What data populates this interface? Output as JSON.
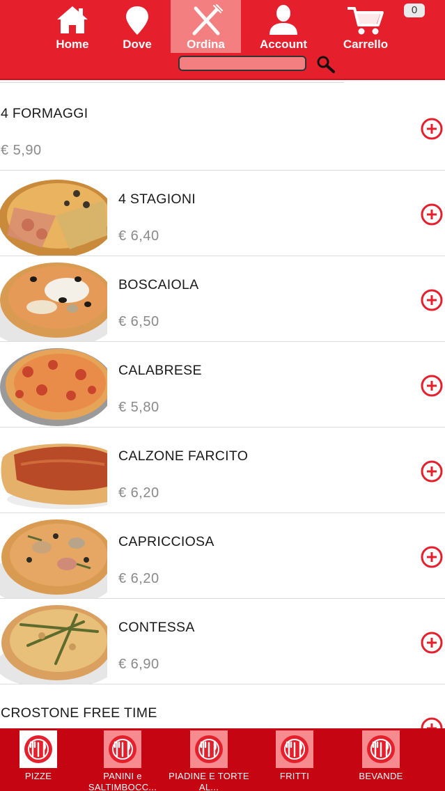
{
  "colors": {
    "brand_red": "#e5202c",
    "active_tab": "#f37f80",
    "tabbar_red": "#c50612",
    "add_icon": "#e5202c"
  },
  "header": {
    "nav": [
      {
        "label": "Home",
        "icon": "home-icon"
      },
      {
        "label": "Dove",
        "icon": "map-pin-icon"
      },
      {
        "label": "Ordina",
        "icon": "cutlery-icon",
        "active": true
      },
      {
        "label": "Account",
        "icon": "user-icon"
      },
      {
        "label": "Carrello",
        "icon": "cart-icon"
      }
    ],
    "cart_count": "0",
    "search": {
      "value": "",
      "placeholder": ""
    }
  },
  "menu": [
    {
      "name": "4 FORMAGGI",
      "price": "€ 5,90",
      "image": false
    },
    {
      "name": "4 STAGIONI",
      "price": "€ 6,40",
      "image": "pizza-4-stagioni"
    },
    {
      "name": "BOSCAIOLA",
      "price": "€ 6,50",
      "image": "pizza-boscaiola"
    },
    {
      "name": "CALABRESE",
      "price": "€ 5,80",
      "image": "pizza-calabrese"
    },
    {
      "name": "CALZONE FARCITO",
      "price": "€ 6,20",
      "image": "calzone"
    },
    {
      "name": "CAPRICCIOSA",
      "price": "€ 6,20",
      "image": "pizza-capricciosa"
    },
    {
      "name": "CONTESSA",
      "price": "€ 6,90",
      "image": "pizza-contessa"
    },
    {
      "name": "CROSTONE FREE TIME",
      "price": "",
      "image": false
    }
  ],
  "tabs": [
    {
      "label": "PIZZE",
      "active": true
    },
    {
      "label": "PANINI e SALTIMBOCC..."
    },
    {
      "label": "PIADINE E TORTE AL..."
    },
    {
      "label": "FRITTI"
    },
    {
      "label": "BEVANDE"
    }
  ]
}
